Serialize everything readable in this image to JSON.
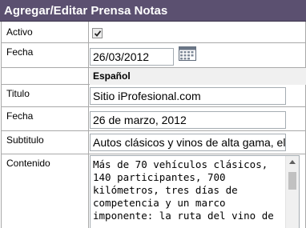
{
  "header": {
    "title": "Agregar/Editar Prensa Notas"
  },
  "form": {
    "activo": {
      "label": "Activo",
      "checked": true
    },
    "fecha": {
      "label": "Fecha",
      "value": "26/03/2012"
    },
    "section_title": "Español",
    "titulo": {
      "label": "Titulo",
      "value": "Sitio iProfesional.com"
    },
    "fecha_texto": {
      "label": "Fecha",
      "value": "26 de marzo, 2012"
    },
    "subtitulo": {
      "label": "Subtitulo",
      "value": "Autos clásicos y vinos de alta gama, el"
    },
    "contenido": {
      "label": "Contenido",
      "value": "Más de 70 vehículos clásicos,\n140 participantes, 700\nkilómetros, tres días de\ncompetencia y un marco\nimponente: la ruta del vino de"
    }
  },
  "icons": {
    "calendar": "calendar-icon",
    "checkmark": "checkmark-icon",
    "scroll_up": "scroll-up-arrow-icon"
  }
}
